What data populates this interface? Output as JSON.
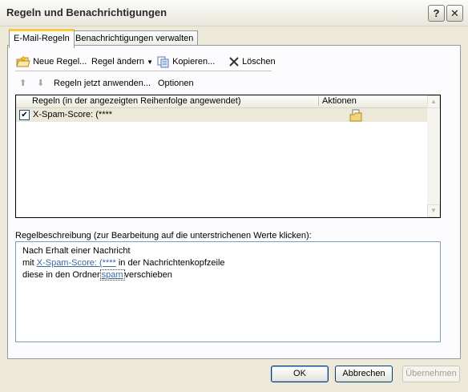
{
  "window": {
    "title": "Regeln und Benachrichtigungen"
  },
  "titlebar": {
    "help": "?",
    "close": "✕"
  },
  "tabs": [
    {
      "label": "E-Mail-Regeln",
      "active": true
    },
    {
      "label": "Benachrichtigungen verwalten",
      "active": false
    }
  ],
  "toolbar": {
    "new_rule": "Neue Regel...",
    "change_rule": "Regel ändern",
    "copy": "Kopieren...",
    "delete": "Löschen"
  },
  "actions": {
    "apply_now": "Regeln jetzt anwenden...",
    "options": "Optionen"
  },
  "rules_list": {
    "columns": [
      "Regeln (in der angezeigten Reihenfolge angewendet)",
      "Aktionen"
    ],
    "rows": [
      {
        "checked": true,
        "name": "X-Spam-Score: (****"
      }
    ]
  },
  "description": {
    "label": "Regelbeschreibung (zur Bearbeitung auf die unterstrichenen Werte klicken):",
    "line1": "Nach Erhalt einer Nachricht",
    "line2_prefix": "mit",
    "line2_link": "X-Spam-Score: (****",
    "line2_suffix": "in der Nachrichtenkopfzeile",
    "line3_prefix": "diese in den Ordner",
    "line3_link": "spam",
    "line3_suffix": "verschieben"
  },
  "buttons": {
    "ok": "OK",
    "cancel": "Abbrechen",
    "apply": "Übernehmen"
  },
  "colors": {
    "dialog_bg": "#ece9d8",
    "link": "#3b6aa0",
    "tab_highlight": "#ffc83c"
  }
}
